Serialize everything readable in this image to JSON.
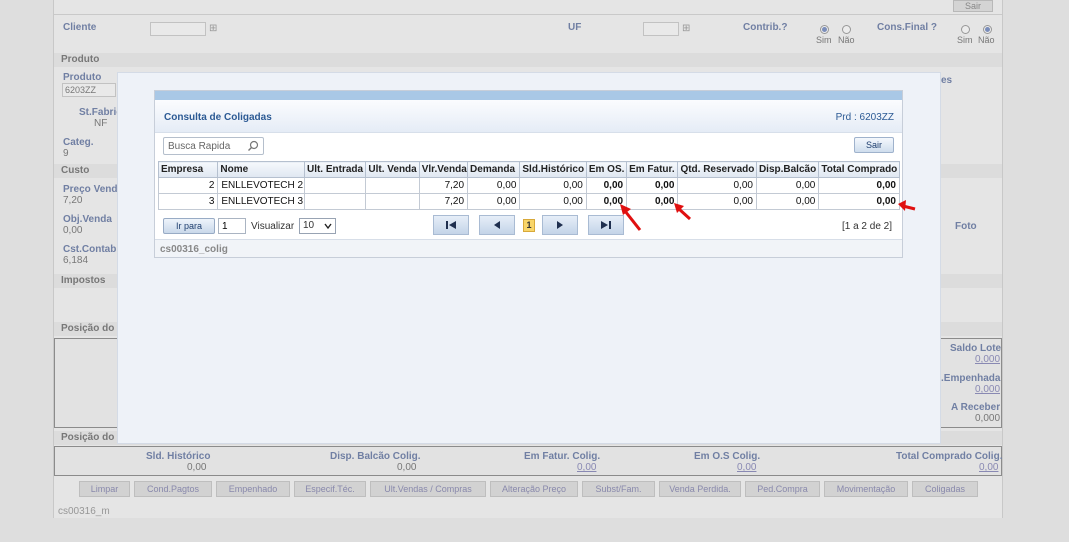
{
  "background": {
    "sair_label": "Sair",
    "cliente_label": "Cliente",
    "uf_label": "UF",
    "contrib_label": "Contrib.?",
    "consfinal_label": "Cons.Final ?",
    "sim_label": "Sim",
    "nao_label": "Não",
    "produto_section": "Produto",
    "produto_label": "Produto",
    "produto_value": "6203ZZ",
    "stfabric_label": "St.Fabric",
    "stfabric_value": "NF",
    "categ_label": "Categ.",
    "categ_value": "9",
    "custo_section": "Custo",
    "precovend_label": "Preço Vend.",
    "precovend_value": "7,20",
    "objvenda_label": "Obj.Venda",
    "objvenda_value": "0,00",
    "cstcontab_label": "Cst.Contab.",
    "cstcontab_value": "6,184",
    "impostos_section": "Impostos",
    "posicao1_section": "Posição do",
    "posicao2_section": "Posição do",
    "es_label": "es",
    "foto_label": "Foto",
    "saldolote_label": "Saldo Lote",
    "saldolote_value": "0,000",
    "empenhada_label": ".Empenhada",
    "empenhada_value": "0,000",
    "areceber_label": "A Receber",
    "areceber_value": "0,000",
    "sldhist_label": "Sld. Histórico",
    "sldhist_value": "0,00",
    "dispbalcao_label": "Disp. Balcão Colig.",
    "dispbalcao_value": "0,00",
    "emfatur_label": "Em Fatur. Colig.",
    "emfatur_value": "0,00",
    "emos_label": "Em O.S Colig.",
    "emos_value": "0,00",
    "totalcomprado_label": "Total Comprado Colig.",
    "totalcomprado_value": "0,00",
    "buttons": [
      "Limpar",
      "Cond.Pagtos",
      "Empenhado",
      "Especif.Téc.",
      "Ult.Vendas / Compras",
      "Alteração Preço",
      "Subst/Fam.",
      "Venda Perdida.",
      "Ped.Compra",
      "Movimentação",
      "Coligadas"
    ],
    "footer_code": "cs00316_m"
  },
  "modal": {
    "title": "Consulta de Coligadas",
    "prd": "Prd : 6203ZZ",
    "search_placeholder": "Busca Rapida",
    "sair_label": "Sair",
    "columns": [
      "Empresa",
      "Nome",
      "Ult. Entrada",
      "Ult. Venda",
      "Vlr.Venda",
      "Demanda",
      "Sld.Histórico",
      "Em OS.",
      "Em Fatur.",
      "Qtd. Reservado",
      "Disp.Balcão",
      "Total Comprado"
    ],
    "rows": [
      {
        "empresa": "2",
        "nome": "ENLLEVOTECH 2",
        "ult_entrada": "",
        "ult_venda": "",
        "vlr_venda": "7,20",
        "demanda": "0,00",
        "sld_historico": "0,00",
        "em_os": "0,00",
        "em_fatur": "0,00",
        "qtd_reservado": "0,00",
        "disp_balcao": "0,00",
        "total_comprado": "0,00"
      },
      {
        "empresa": "3",
        "nome": "ENLLEVOTECH 3",
        "ult_entrada": "",
        "ult_venda": "",
        "vlr_venda": "7,20",
        "demanda": "0,00",
        "sld_historico": "0,00",
        "em_os": "0,00",
        "em_fatur": "0,00",
        "qtd_reservado": "0,00",
        "disp_balcao": "0,00",
        "total_comprado": "0,00"
      }
    ],
    "ir_para_label": "Ir para",
    "page_input_value": "1",
    "visualizar_label": "Visualizar",
    "visualizar_value": "10",
    "current_page": "1",
    "page_info": "[1 a 2 de 2]",
    "footer_code": "cs00316_colig"
  },
  "colors": {
    "accent_blue": "#2c5a94",
    "link_blue": "#1a30b8",
    "annotation_red": "#e01010"
  }
}
